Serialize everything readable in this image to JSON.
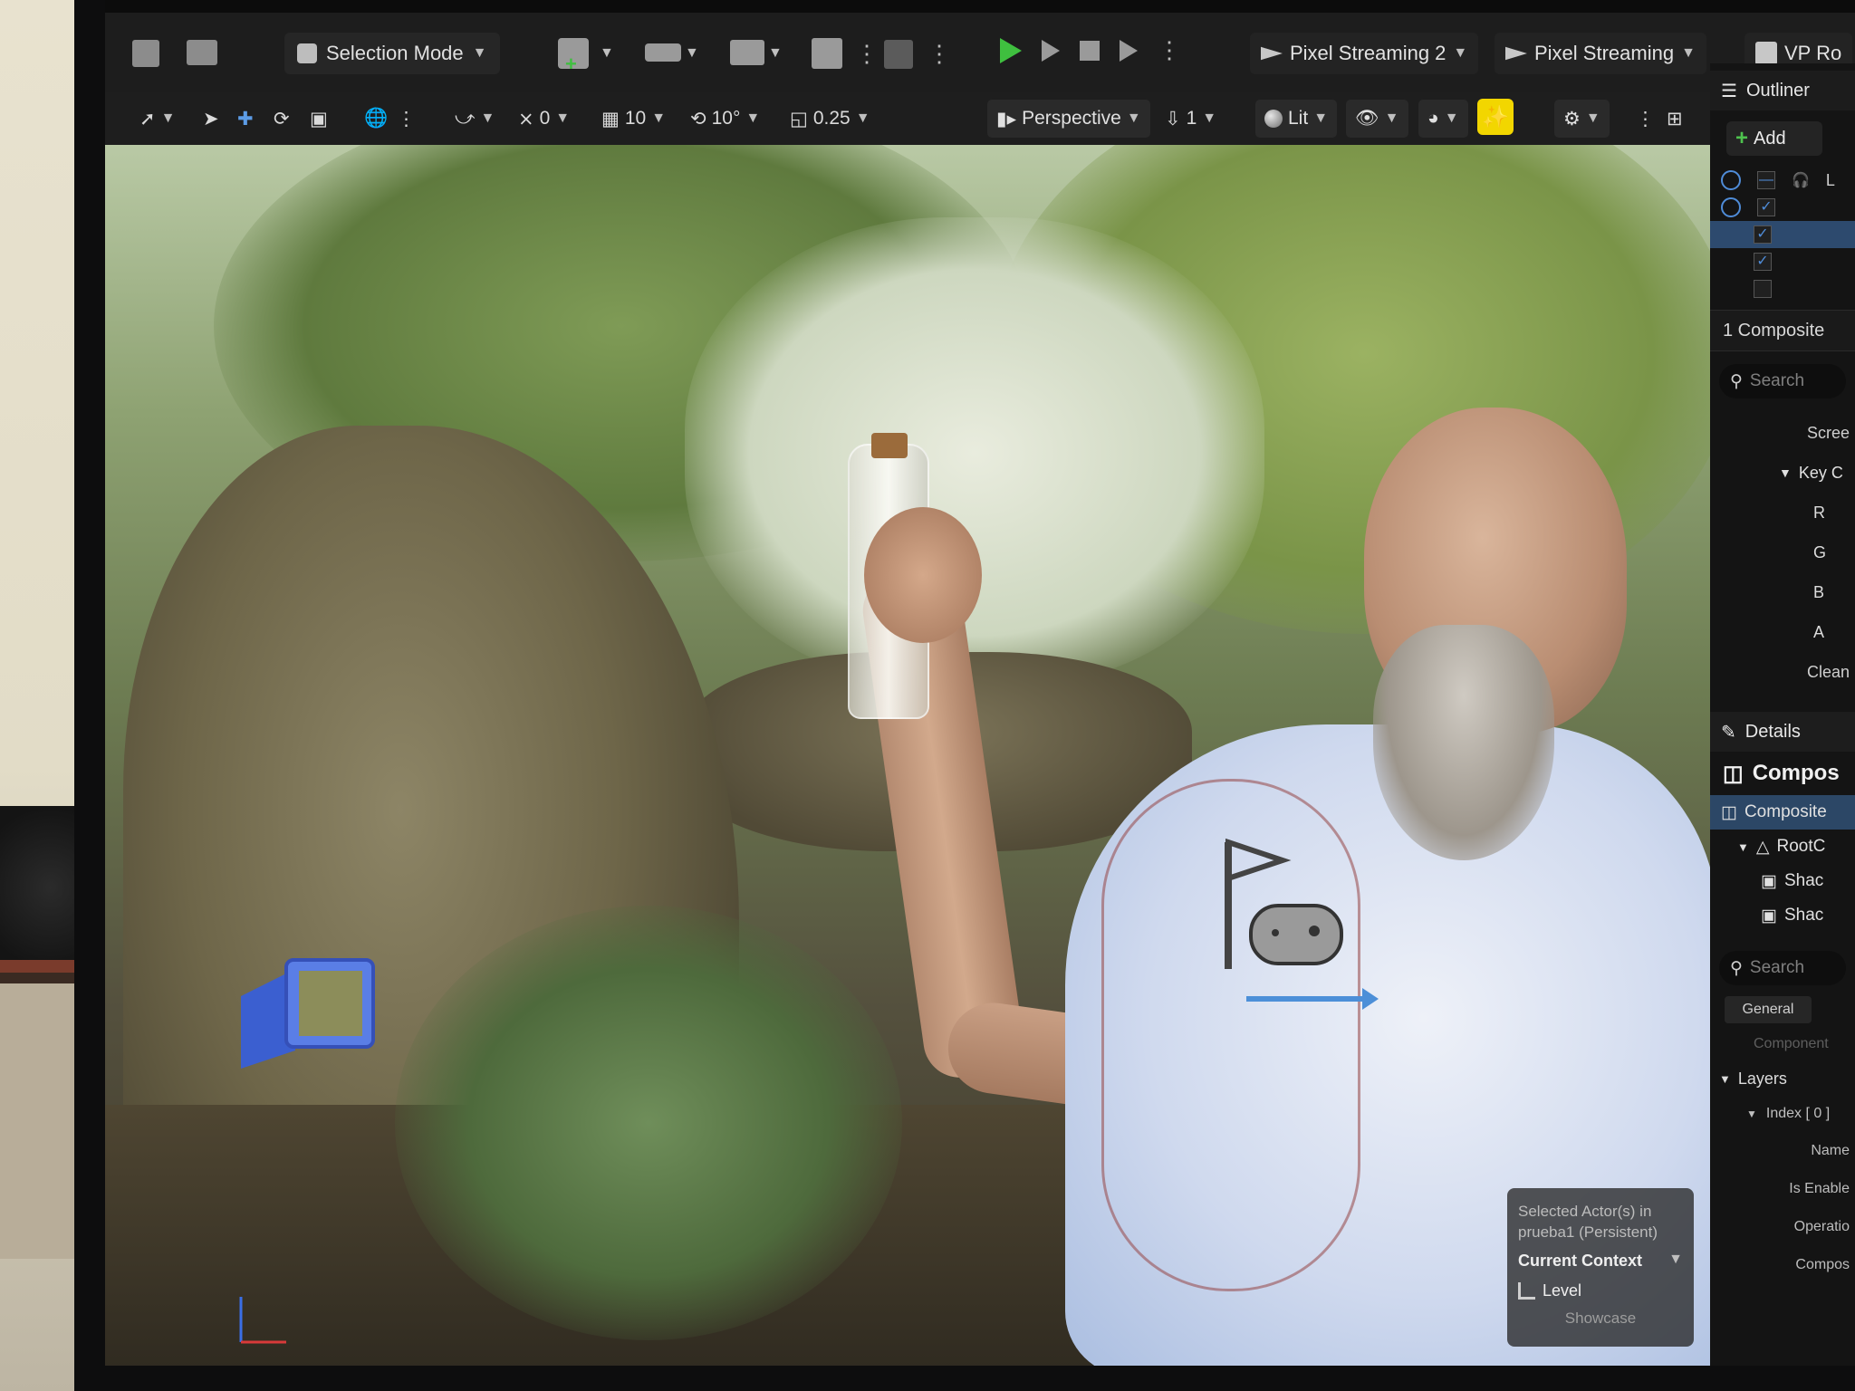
{
  "main_toolbar": {
    "mode_label": "Selection Mode",
    "pixel_streaming_2": "Pixel Streaming 2",
    "pixel_streaming": "Pixel Streaming",
    "vp_label": "VP Ro"
  },
  "viewport_toolbar": {
    "translate_snap": "0",
    "grid_snap": "10",
    "rotate_snap": "10°",
    "scale_snap": "0.25",
    "view_mode": "Perspective",
    "camera_speed": "1",
    "lighting_mode": "Lit"
  },
  "outliner": {
    "tab_label": "Outliner",
    "add_label": "Add",
    "header_letter": "L",
    "count_label": "1 Composite",
    "search_placeholder": "Search",
    "props": {
      "screen": "Scree",
      "key": "Key C"
    },
    "channels": [
      "R",
      "G",
      "B",
      "A"
    ],
    "clean": "Clean"
  },
  "details": {
    "tab_label": "Details",
    "title": "Compos",
    "tree": {
      "root_actor": "Composite",
      "root_component": "RootC",
      "child_1": "Shac",
      "child_2": "Shac"
    },
    "search_placeholder": "Search",
    "category_general": "General",
    "faded_label": "Component",
    "layers_label": "Layers",
    "index_label": "Index [ 0 ]",
    "rows": [
      "Name",
      "Is Enable",
      "Operatio",
      "Compos"
    ]
  },
  "context_overlay": {
    "selected_line1": "Selected Actor(s) in",
    "selected_line2": "prueba1 (Persistent)",
    "title": "Current Context",
    "level": "Level",
    "showcase": "Showcase"
  },
  "colors": {
    "play_green": "#3fbf3f",
    "accent_yellow": "#f2d600",
    "selection_blue": "#2d4a6e",
    "editor_bg": "#1d1d1d"
  }
}
